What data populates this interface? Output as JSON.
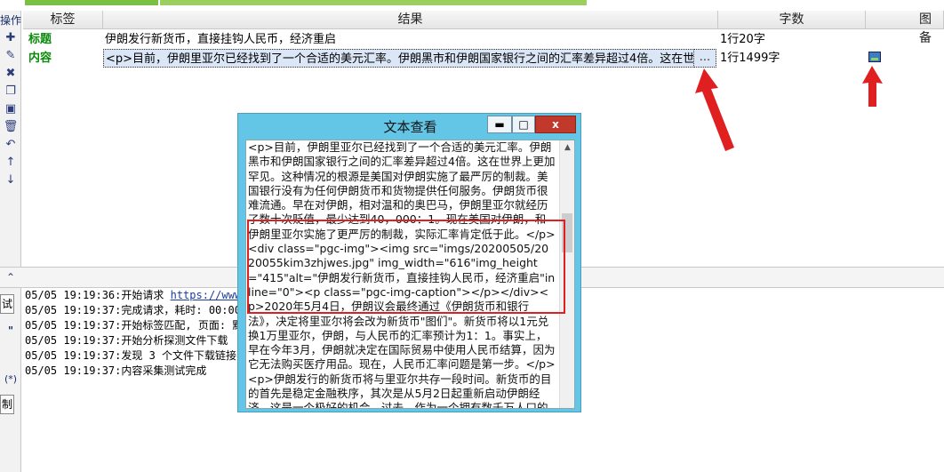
{
  "toolbar": {
    "title": "操作",
    "icons": [
      "plus-icon",
      "pencil-icon",
      "delete-icon",
      "copy-icon",
      "paste-icon",
      "trash-icon",
      "undo-icon",
      "up-icon",
      "down-icon"
    ],
    "side_labels": [
      "试",
      "\"",
      "(*)",
      "制"
    ]
  },
  "grid": {
    "headers": [
      "标签",
      "结果",
      "字数",
      "图备"
    ],
    "rows": [
      {
        "tag": "标题",
        "result": "伊朗发行新货币，直接挂钩人民币，经济重启",
        "count": "1行20字"
      },
      {
        "tag": "内容",
        "result": "<p>目前，伊朗里亚尔已经找到了一个合适的美元汇率。伊朗黑市和伊朗国家银行之间的汇率差异超过4倍。这在世界上更加罕",
        "ellipsis": "...",
        "count": "1行1499字"
      }
    ]
  },
  "log": {
    "lines": [
      {
        "time": "05/05 19:19:36:",
        "text": "开始请求 ",
        "url": "https://www.tout"
      },
      {
        "time": "05/05 19:19:37:",
        "text": "完成请求，耗时: 00:00:00."
      },
      {
        "time": "05/05 19:19:37:",
        "text": "开始标签匹配, 页面: 默认页"
      },
      {
        "time": "05/05 19:19:37:",
        "text": "开始分析探测文件下载"
      },
      {
        "time": "05/05 19:19:37:",
        "text": "发现 3 个文件下载链接"
      },
      {
        "time": "05/05 19:19:37:",
        "text": "内容采集测试完成"
      }
    ]
  },
  "window": {
    "title": "文本查看",
    "buttons": [
      "▬",
      "□",
      "x"
    ],
    "text": "<p>目前，伊朗里亚尔已经找到了一个合适的美元汇率。伊朗黑市和伊朗国家银行之间的汇率差异超过4倍。这在世界上更加罕见。这种情况的根源是美国对伊朗实施了最严厉的制裁。美国银行没有为任何伊朗货币和货物提供任何服务。伊朗货币很难流通。早在对伊朗，相对温和的奥巴马，伊朗里亚尔就经历了数十次贬值，最少达到40，000：1。现在美国对伊朗，和伊朗里亚尔实施了更严厉的制裁，实际汇率肯定低于此。</p><div class=\"pgc-img\"><img src=\"imgs/20200505/2020055kim3zhjwes.jpg\" img_width=\"616\"img_height=\"415\"alt=\"伊朗发行新货币，直接挂钩人民币，经济重启\"inline=\"0\"><p class=\"pgc-img-caption\"></p></div><p>2020年5月4日，伊朗议会最终通过《伊朗货币和银行法》，决定将里亚尔将会改为新货币\"图们\"。新货币将以1元兑换1万里亚尔，伊朗，与人民币的汇率预计为1：1。事实上，早在今年3月，伊朗就决定在国际贸易中使用人民币结算，因为它无法购买医疗用品。现在，人民币汇率问题是第一步。</p><p>伊朗发行的新货币将与里亚尔共存一段时间。新货币的目的首先是稳定金融秩序，其次是从5月2日起重新启动伊朗经济。这是一个极好的机会。过去，作为一个拥有数千万人口的国家，完全当然人民消费者取代伊朗"
  },
  "colors": {
    "accent_green": "#7ac043",
    "window_blue": "#63c6e6",
    "arrow_red": "#e02020",
    "tag_green": "#0a8a0a"
  }
}
